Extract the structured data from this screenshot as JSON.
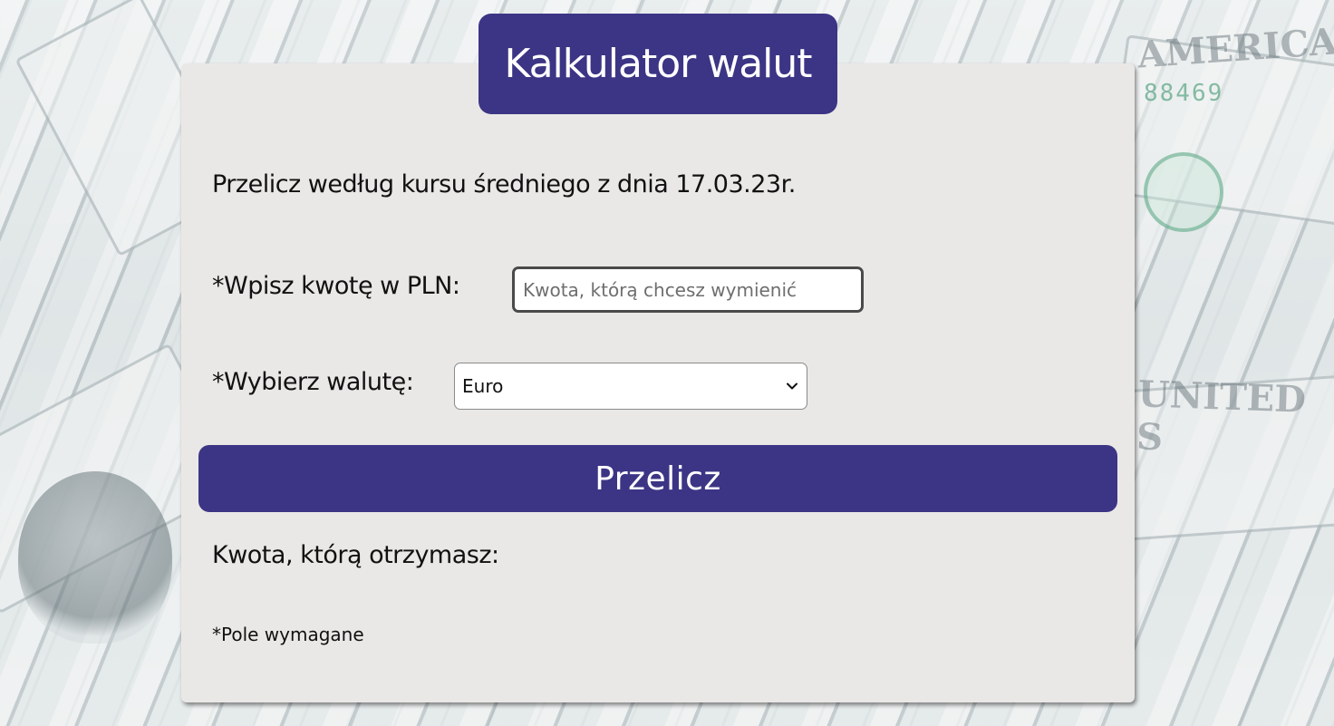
{
  "header": {
    "title": "Kalkulator walut"
  },
  "form": {
    "subtitle": "Przelicz według kursu średniego z dnia 17.03.23r.",
    "amount_label": "*Wpisz kwotę w PLN:",
    "amount_placeholder": "Kwota, którą chcesz wymienić",
    "amount_value": "",
    "currency_label": "*Wybierz walutę:",
    "currency_selected": "Euro",
    "convert_label": "Przelicz",
    "result_label": "Kwota, którą otrzymasz:",
    "required_note": "*Pole wymagane"
  },
  "background": {
    "serial": "88469",
    "bill_text_top": "AMERICA",
    "bill_text_mid": "UNITED S"
  },
  "colors": {
    "accent": "#3c3585",
    "card": "#eae8e6",
    "text": "#111111"
  },
  "icons": {
    "select_arrow": "chevron-down-icon"
  }
}
